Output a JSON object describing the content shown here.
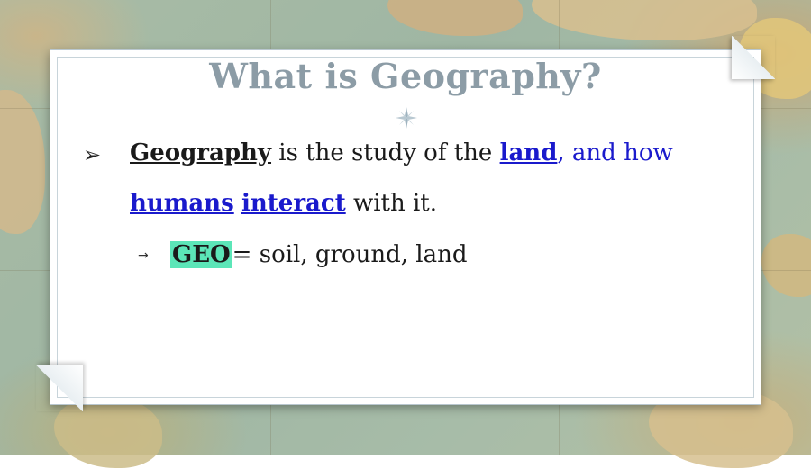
{
  "slide": {
    "title": "What is Geography?",
    "bullet1": {
      "term": "Geography",
      "text1": " is the study of the ",
      "land": "land",
      "text2": ", and how",
      "humans": "humans",
      "space": " ",
      "interact": "interact",
      "text3": " with it."
    },
    "sub_bullet": {
      "term": "GEO",
      "text": "= soil, ground, land"
    },
    "bullet_glyph": "➢",
    "sub_bullet_glyph": "→"
  },
  "colors": {
    "title": "#8c9ca6",
    "link_blue": "#1a1acc",
    "highlight": "#5ce6b8"
  },
  "icons": {
    "title_ornament": "compass-rose-icon",
    "background": "vintage-map"
  }
}
